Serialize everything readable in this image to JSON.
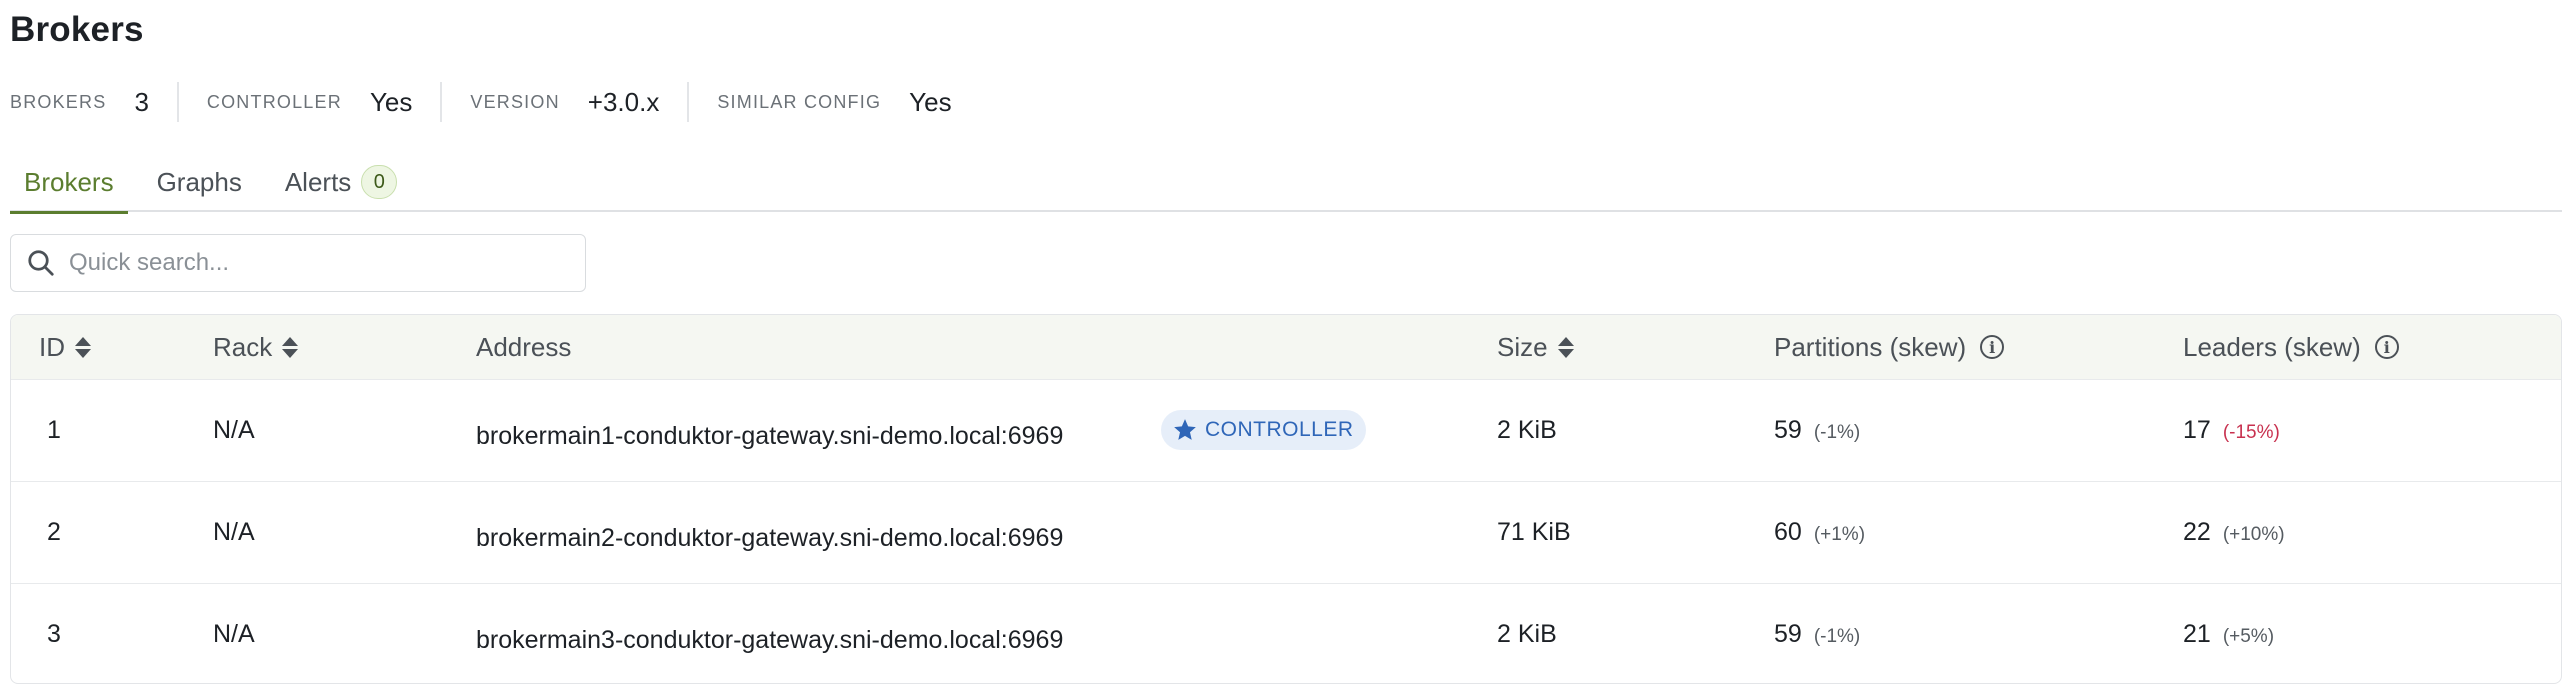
{
  "page": {
    "title": "Brokers"
  },
  "stats": [
    {
      "label": "BROKERS",
      "value": "3"
    },
    {
      "label": "CONTROLLER",
      "value": "Yes"
    },
    {
      "label": "VERSION",
      "value": "+3.0.x"
    },
    {
      "label": "SIMILAR CONFIG",
      "value": "Yes"
    }
  ],
  "tabs": [
    {
      "label": "Brokers",
      "active": true
    },
    {
      "label": "Graphs",
      "active": false
    },
    {
      "label": "Alerts",
      "active": false,
      "badge": "0"
    }
  ],
  "search": {
    "placeholder": "Quick search...",
    "value": "",
    "icon": "search-icon"
  },
  "table": {
    "columns": [
      {
        "label": "ID",
        "sortable": true
      },
      {
        "label": "Rack",
        "sortable": true
      },
      {
        "label": "Address",
        "sortable": false
      },
      {
        "label": "Size",
        "sortable": true
      },
      {
        "label": "Partitions (skew)",
        "info": true
      },
      {
        "label": "Leaders (skew)",
        "info": true
      }
    ],
    "rows": [
      {
        "id": "1",
        "rack": "N/A",
        "address": "brokermain1-conduktor-gateway.sni-demo.local:6969",
        "badge": "CONTROLLER",
        "size": "2 KiB",
        "partitions": "59",
        "partitions_skew": "(-1%)",
        "leaders": "17",
        "leaders_skew": "(-15%)"
      },
      {
        "id": "2",
        "rack": "N/A",
        "address": "brokermain2-conduktor-gateway.sni-demo.local:6969",
        "badge": "",
        "size": "71 KiB",
        "partitions": "60",
        "partitions_skew": "(+1%)",
        "leaders": "22",
        "leaders_skew": "(+10%)"
      },
      {
        "id": "3",
        "rack": "N/A",
        "address": "brokermain3-conduktor-gateway.sni-demo.local:6969",
        "badge": "",
        "size": "2 KiB",
        "partitions": "59",
        "partitions_skew": "(-1%)",
        "leaders": "21",
        "leaders_skew": "(+5%)"
      }
    ]
  },
  "colors": {
    "accent": "#5b7d2f",
    "controller_badge": "#2f66b8",
    "negative_skew": "#c8314f"
  },
  "icons": {
    "controller_badge": "star-icon",
    "column_info": "info-icon",
    "sort": "sort-icon"
  }
}
